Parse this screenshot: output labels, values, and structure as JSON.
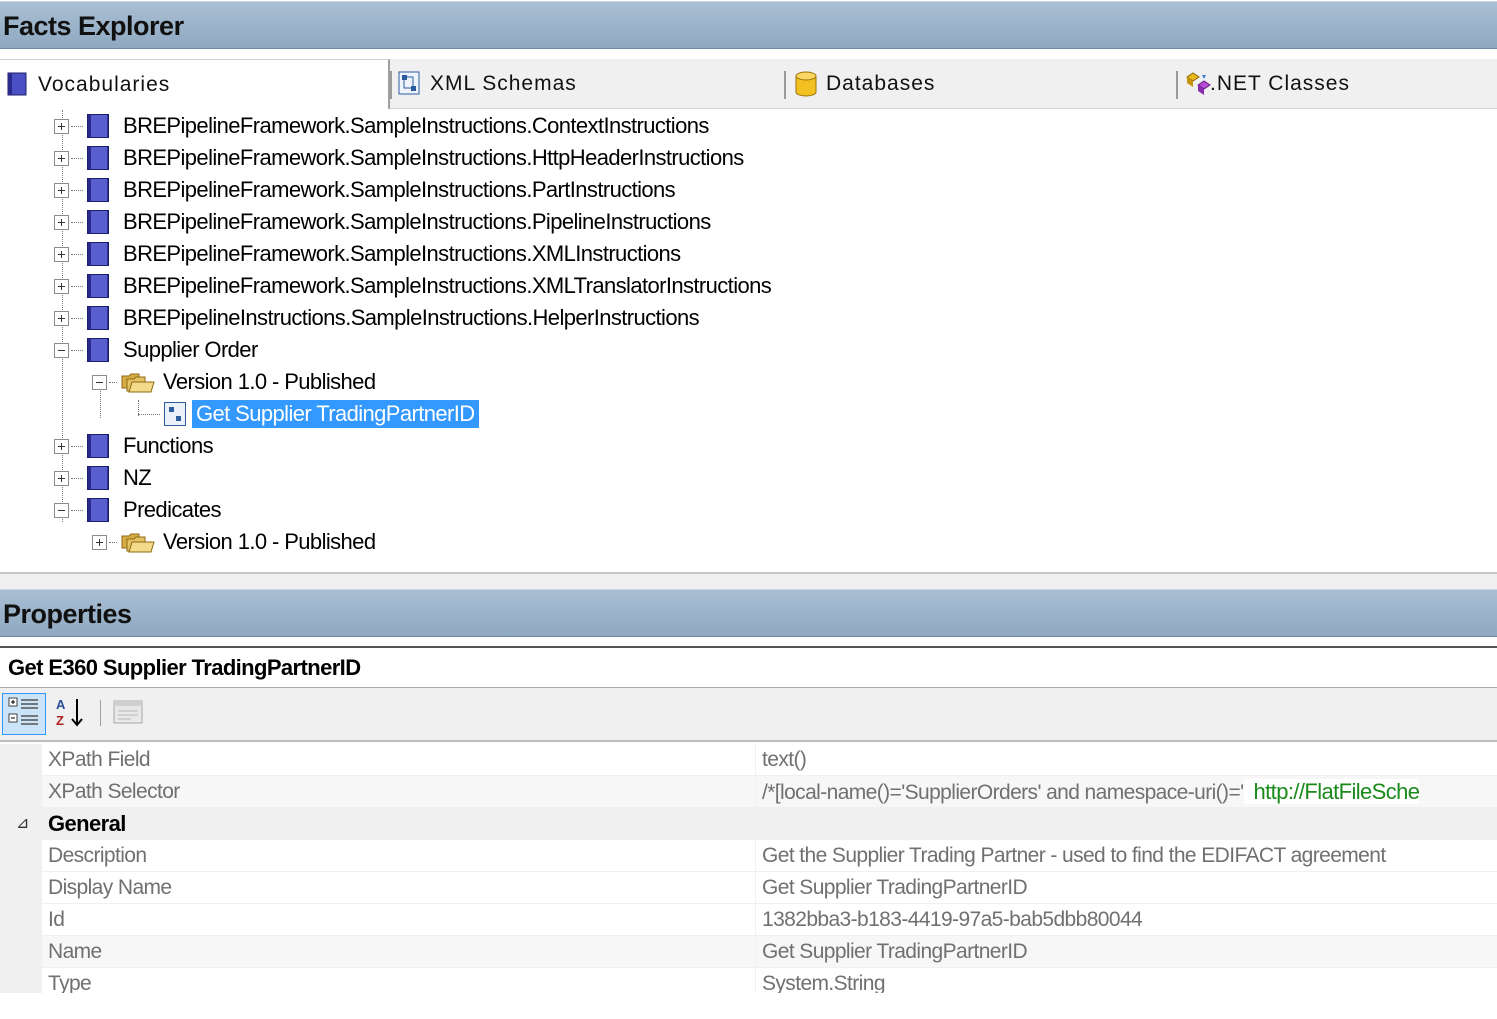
{
  "facts_explorer": {
    "title": "Facts Explorer",
    "tabs": [
      {
        "label": "Vocabularies",
        "icon": "vocabulary-book-icon",
        "active": true
      },
      {
        "label": "XML Schemas",
        "icon": "xml-schema-icon",
        "active": false
      },
      {
        "label": "Databases",
        "icon": "database-cylinder-icon",
        "active": false
      },
      {
        "label": ".NET Classes",
        "icon": "dotnet-classes-icon",
        "active": false
      }
    ],
    "tree": [
      {
        "label": "BREPipelineFramework.SampleInstructions.ContextInstructions",
        "expanded": false
      },
      {
        "label": "BREPipelineFramework.SampleInstructions.HttpHeaderInstructions",
        "expanded": false
      },
      {
        "label": "BREPipelineFramework.SampleInstructions.PartInstructions",
        "expanded": false
      },
      {
        "label": "BREPipelineFramework.SampleInstructions.PipelineInstructions",
        "expanded": false
      },
      {
        "label": "BREPipelineFramework.SampleInstructions.XMLInstructions",
        "expanded": false
      },
      {
        "label": "BREPipelineFramework.SampleInstructions.XMLTranslatorInstructions",
        "expanded": false
      },
      {
        "label": "BREPipelineInstructions.SampleInstructions.HelperInstructions",
        "expanded": false
      },
      {
        "label": "Supplier Order",
        "expanded": true
      },
      {
        "label": "Version 1.0 - Published",
        "expanded": true
      },
      {
        "label": "Get Supplier TradingPartnerID",
        "selected": true
      },
      {
        "label": "Functions",
        "expanded": false
      },
      {
        "label": "NZ",
        "expanded": false
      },
      {
        "label": "Predicates",
        "expanded": true
      },
      {
        "label": "Version 1.0 - Published",
        "expanded": false
      }
    ]
  },
  "properties": {
    "title": "Properties",
    "object_name": "Get E360 Supplier TradingPartnerID",
    "toolbar": {
      "categorized_icon": "categorized-view-icon",
      "alphabetical_icon": "sort-alphabetical-icon",
      "property_pages_icon": "property-pages-icon"
    },
    "rows_top": [
      {
        "name": "XPath Field",
        "value": "text()"
      },
      {
        "name": "XPath Selector",
        "value": "/*[local-name()='SupplierOrders' and namespace-uri()='",
        "value_extra": "http://FlatFileSche"
      }
    ],
    "category": {
      "name": "General",
      "toggle": "⊿"
    },
    "rows_general": [
      {
        "name": "Description",
        "value": "Get the Supplier Trading Partner - used to find the EDIFACT agreement"
      },
      {
        "name": "Display Name",
        "value": "Get  Supplier TradingPartnerID"
      },
      {
        "name": "Id",
        "value": "1382bba3-b183-4419-97a5-bab5dbb80044"
      },
      {
        "name": "Name",
        "value": "Get Supplier TradingPartnerID"
      },
      {
        "name": "Type",
        "value": "System.String"
      }
    ]
  }
}
